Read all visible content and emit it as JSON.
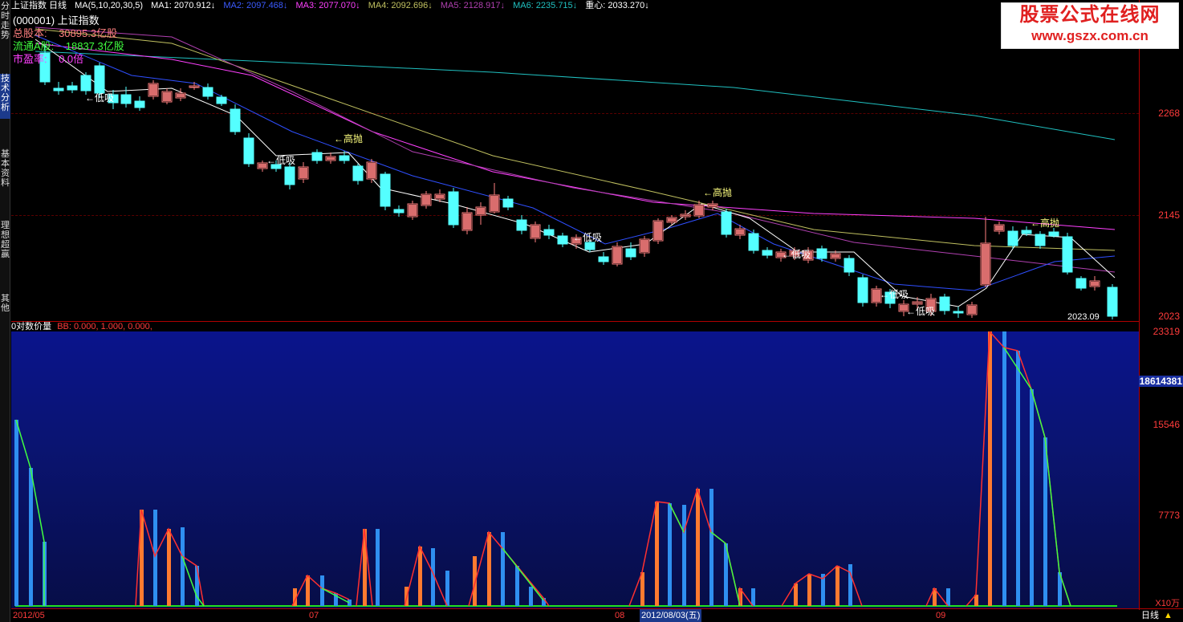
{
  "left_tabs": [
    {
      "label": "分时走势",
      "active": false
    },
    {
      "label": "技术分析",
      "active": true
    },
    {
      "label": "基本资料",
      "active": false
    },
    {
      "label": "理想超赢",
      "active": false
    },
    {
      "label": "其他",
      "active": false
    }
  ],
  "top_info": {
    "title": "上证指数",
    "period": "日线",
    "ma_spec": "MA(5,10,20,30,5)",
    "ma1": "MA1: 2070.912↓",
    "ma2": "MA2: 2097.468↓",
    "ma3": "MA3: 2077.070↓",
    "ma4": "MA4: 2092.696↓",
    "ma5": "MA5: 2128.917↓",
    "ma6": "MA6: 2235.715↓",
    "zhongxin": "重心: 2033.270↓"
  },
  "stock_info": {
    "name": "(000001) 上证指数",
    "total_shares_label": "总股本:",
    "total_shares": "30895.3亿股",
    "float_shares_label": "流通A股:",
    "float_shares": "18837.3亿股",
    "pe_label": "市盈率:",
    "pe": "0.0倍"
  },
  "price_axis": [
    "2268",
    "2145",
    "2023"
  ],
  "last_price_label": "2023.09",
  "signals": {
    "high": "高抛",
    "low": "低吸",
    "arrow": "←"
  },
  "volume_header": {
    "title": "0对数价量",
    "params": "BB: 0.000, 1.000, 0.000,"
  },
  "volume_axis": [
    "23319",
    "18614381",
    "15546",
    "7773",
    "X10万"
  ],
  "bottom": {
    "dates": [
      "2012/05",
      "07",
      "08",
      "2012/08/03(五)",
      "09"
    ],
    "period_button": "日线"
  },
  "logo": {
    "line1": "股票公式在线网",
    "line2": "www.gszx.com.cn"
  },
  "colors": {
    "up": "#ff8080",
    "down": "#54ffff",
    "axis": "#ff3b3b",
    "ma1": "#ffffff",
    "ma2": "#2f4fff",
    "ma3": "#ff40ff",
    "ma4": "#c0c060",
    "ma6": "#20c0c0"
  }
}
